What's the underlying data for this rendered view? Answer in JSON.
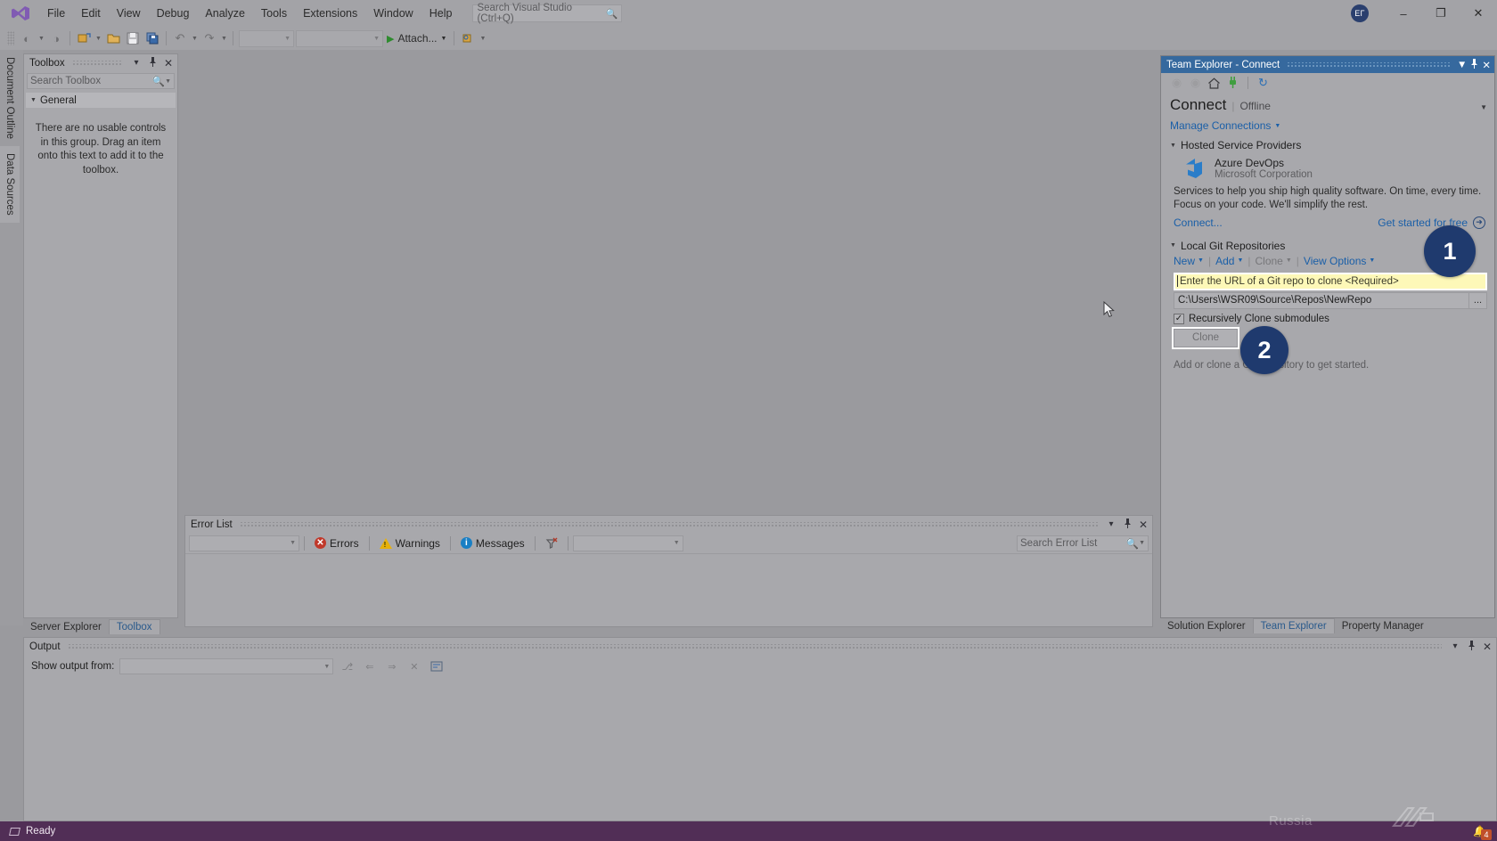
{
  "app": {
    "title": "Visual Studio",
    "logo_name": "visual-studio-logo"
  },
  "menubar": {
    "items": [
      {
        "label": "File"
      },
      {
        "label": "Edit"
      },
      {
        "label": "View"
      },
      {
        "label": "Debug"
      },
      {
        "label": "Analyze"
      },
      {
        "label": "Tools"
      },
      {
        "label": "Extensions"
      },
      {
        "label": "Window"
      },
      {
        "label": "Help"
      }
    ],
    "search_placeholder": "Search Visual Studio (Ctrl+Q)",
    "search_value": ""
  },
  "titlebar": {
    "avatar_initials": "ЕГ",
    "minimize": "–",
    "restore": "❐",
    "close": "✕"
  },
  "toolbar": {
    "nav_back": "◀",
    "nav_forward": "▶",
    "new_project": "new-project-icon",
    "open_file": "open-file-icon",
    "save": "save-icon",
    "save_all": "save-all-icon",
    "undo": "↶",
    "redo": "↷",
    "combo_one": "",
    "combo_two": "",
    "attach_label": "Attach...",
    "quick_launch": "quick-launch-icon",
    "live_share": "Live Share",
    "feedback": "feedback-icon"
  },
  "left_strip": {
    "tabs": [
      {
        "label": "Document Outline"
      },
      {
        "label": "Data Sources"
      }
    ]
  },
  "toolbox": {
    "title": "Toolbox",
    "search_placeholder": "Search Toolbox",
    "search_value": "",
    "group": "General",
    "empty_message": "There are no usable controls in this group. Drag an item onto this text to add it to the toolbox.",
    "pin": "📌",
    "dropdown": "▾",
    "close": "✕"
  },
  "bottom_left_tabs": {
    "items": [
      {
        "label": "Server Explorer",
        "selected": false
      },
      {
        "label": "Toolbox",
        "selected": true
      }
    ]
  },
  "error_list": {
    "title": "Error List",
    "scope_value": "",
    "filters": [
      {
        "label": "Errors",
        "icon": "error-icon",
        "glyph": "✕"
      },
      {
        "label": "Warnings",
        "icon": "warning-icon",
        "glyph": "!"
      },
      {
        "label": "Messages",
        "icon": "message-icon",
        "glyph": "i"
      }
    ],
    "clear_filter_icon": "clear-filter-icon",
    "build_combo_value": "",
    "search_placeholder": "Search Error List",
    "search_value": "",
    "dropdown": "▾",
    "pin": "📌",
    "close": "✕"
  },
  "output": {
    "title": "Output",
    "show_output_from_label": "Show output from:",
    "source_value": "",
    "buttons": [
      {
        "name": "find-message-icon",
        "glyph": "⎇"
      },
      {
        "name": "go-to-previous-icon",
        "glyph": "⇐"
      },
      {
        "name": "go-to-next-icon",
        "glyph": "⇒"
      },
      {
        "name": "clear-all-icon",
        "glyph": "✕"
      },
      {
        "name": "toggle-word-wrap-icon",
        "glyph": "≡"
      }
    ],
    "dropdown": "▾",
    "pin": "📌",
    "close": "✕"
  },
  "team_explorer": {
    "window_title": "Team Explorer - Connect",
    "toolbar": {
      "back": "◀",
      "forward": "▶",
      "home": "home-icon",
      "connect": "plug-icon",
      "refresh": "↻"
    },
    "heading": "Connect",
    "heading_status": "Offline",
    "manage_connections": "Manage Connections",
    "sections": {
      "hosted": {
        "title": "Hosted Service Providers",
        "provider_name": "Azure DevOps",
        "provider_company": "Microsoft Corporation",
        "description": "Services to help you ship high quality software. On time, every time. Focus on your code. We'll simplify the rest.",
        "connect_link": "Connect...",
        "get_started_link": "Get started for free"
      },
      "local": {
        "title": "Local Git Repositories",
        "actions": [
          {
            "label": "New",
            "enabled": true
          },
          {
            "label": "Add",
            "enabled": true
          },
          {
            "label": "Clone",
            "enabled": false
          },
          {
            "label": "View Options",
            "enabled": true
          }
        ],
        "url_placeholder": "Enter the URL of a Git repo to clone <Required>",
        "url_value": "",
        "path_value": "C:\\Users\\WSR09\\Source\\Repos\\NewRepo",
        "browse_label": "...",
        "checkbox_label": "Recursively Clone submodules",
        "checkbox_checked": true,
        "clone_button": "Clone",
        "empty_note": "Add or clone a Git repository to get started."
      }
    }
  },
  "te_bottom_tabs": {
    "items": [
      {
        "label": "Solution Explorer",
        "selected": false
      },
      {
        "label": "Team Explorer",
        "selected": true
      },
      {
        "label": "Property Manager",
        "selected": false
      }
    ]
  },
  "callouts": [
    {
      "number": "1"
    },
    {
      "number": "2"
    }
  ],
  "statusbar": {
    "status": "Ready",
    "notification_count": "4",
    "watermark": "Russia"
  },
  "colors": {
    "accent_blue": "#36699e",
    "link_blue": "#1a5fa8",
    "callout_navy": "#1f3a6e",
    "statusbar_purple": "#512e56",
    "highlight_yellow": "#fdf8b8",
    "error_red": "#c0392b",
    "warning_yellow": "#e8b10a",
    "message_blue": "#1a7fc4"
  }
}
